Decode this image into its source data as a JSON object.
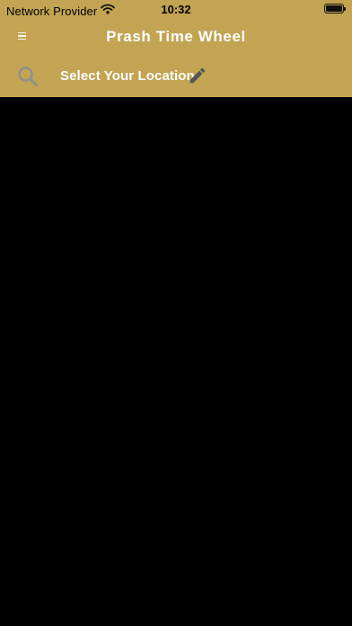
{
  "status_bar": {
    "carrier": "Network Provider",
    "time": "10:32",
    "icons": [
      "wifi-icon",
      "battery-icon"
    ]
  },
  "nav": {
    "title": "Prash Time Wheel",
    "menu_icon": "menu-icon"
  },
  "location": {
    "label": "Select Your Location",
    "search_icon": "search-icon",
    "edit_icon": "pencil-icon"
  },
  "colors": {
    "header_background": "#c2a452",
    "content_background": "#000000",
    "header_text": "#ffffff",
    "icon_gray": "#8f8f8f"
  }
}
